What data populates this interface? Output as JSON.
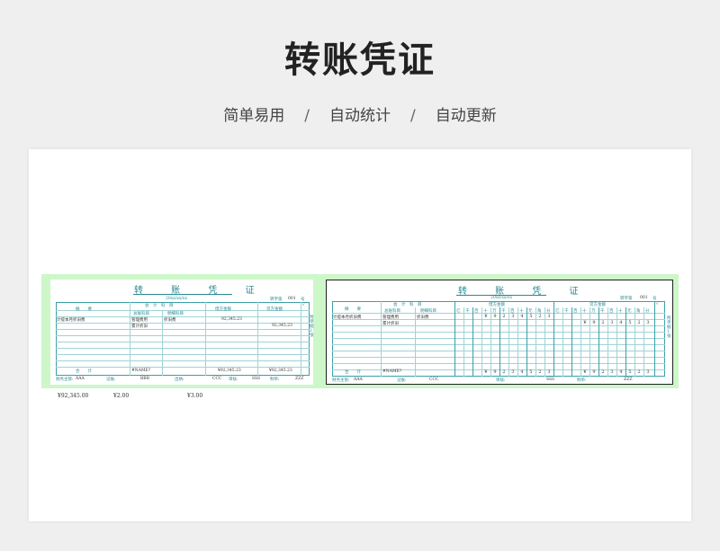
{
  "header": {
    "title": "转账凭证",
    "features": [
      "简单易用",
      "自动统计",
      "自动更新"
    ],
    "separator": "/"
  },
  "voucher": {
    "title": "转 账 凭 证",
    "date": "20xx/xx/xx",
    "number_label": "转字第",
    "number": "001",
    "number_unit": "号",
    "col_summary": "摘　　要",
    "col_account": "会　计　科　目",
    "col_general_account": "总账科目",
    "col_detail_account": "明细科目",
    "col_debit": "借方金额",
    "col_credit": "贷方金额",
    "col_check": "√",
    "col_attach": "附单据1张",
    "digit_headers": [
      "亿",
      "千",
      "百",
      "十",
      "万",
      "千",
      "百",
      "十",
      "元",
      "角",
      "分"
    ],
    "row": {
      "summary": "计提本月折旧费",
      "general_1": "管理费用",
      "detail_1": "折旧费",
      "general_2": "累计折旧",
      "debit": "92,345.23",
      "credit": "92,345.23"
    },
    "debit_digits": [
      "¥",
      "9",
      "2",
      "3",
      "4",
      "5",
      "2",
      "3"
    ],
    "credit_digits": [
      "¥",
      "9",
      "2",
      "3",
      "4",
      "5",
      "2",
      "3"
    ],
    "total_label": "合　　计",
    "total_words": "#NAME?",
    "total_debit": "¥92,345.23",
    "total_credit": "¥92,345.23",
    "sign": {
      "supervisor_label": "财务主管:",
      "supervisor": "AAA",
      "bookkeeper_label": "记账:",
      "bookkeeper": "BBB",
      "cashier_label": "出纳:",
      "cashier": "CCC",
      "auditor_label": "审核:",
      "auditor": "SSS",
      "maker_label": "制单:",
      "maker": "ZZZ"
    }
  },
  "below": {
    "amount": "¥92,345.00",
    "value_2": "¥2.00",
    "value_3": "¥3.00"
  }
}
